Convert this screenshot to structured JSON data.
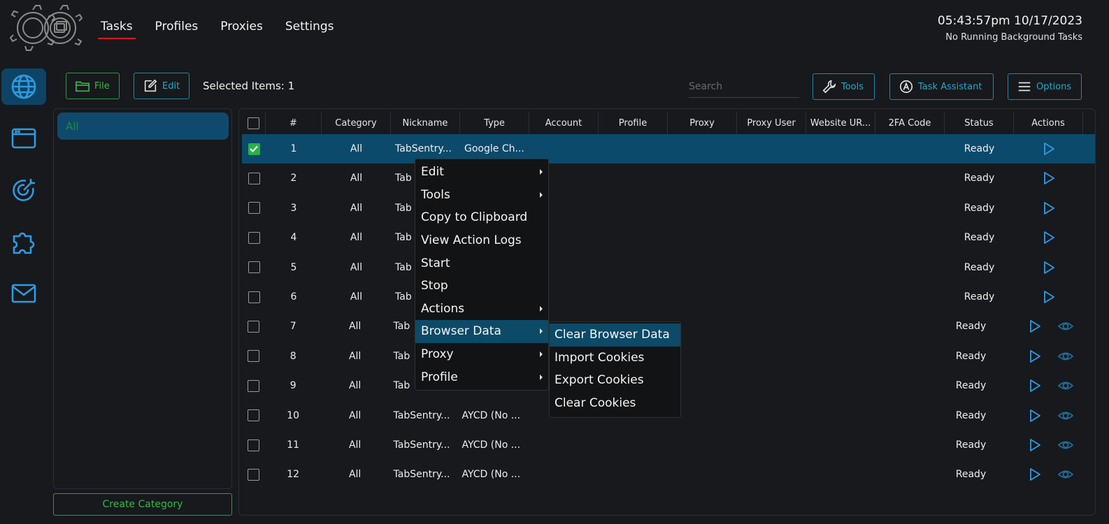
{
  "nav": {
    "tabs": [
      {
        "label": "Tasks"
      },
      {
        "label": "Profiles"
      },
      {
        "label": "Proxies"
      },
      {
        "label": "Settings"
      }
    ]
  },
  "header": {
    "clock": "05:43:57pm 10/17/2023",
    "background_status": "No Running Background Tasks"
  },
  "sidebar": {
    "items": [
      {
        "icon": "globe-icon"
      },
      {
        "icon": "browser-window-icon"
      },
      {
        "icon": "target-icon"
      },
      {
        "icon": "puzzle-icon"
      },
      {
        "icon": "mail-icon"
      }
    ]
  },
  "toolbar": {
    "file_label": "File",
    "edit_label": "Edit",
    "selected_items": "Selected Items: 1",
    "search_placeholder": "Search",
    "tools_label": "Tools",
    "task_assistant_label": "Task Assistant",
    "options_label": "Options"
  },
  "categories": {
    "items": [
      {
        "label": "All"
      }
    ],
    "create_label": "Create Category"
  },
  "table": {
    "columns": [
      "#",
      "Category",
      "Nickname",
      "Type",
      "Account",
      "Profile",
      "Proxy",
      "Proxy User",
      "Website UR...",
      "2FA Code",
      "Status",
      "Actions"
    ],
    "rows": [
      {
        "num": "1",
        "category": "All",
        "nickname": "TabSentry...",
        "type": "Google Ch...",
        "status": "Ready",
        "checked": true,
        "eye": false
      },
      {
        "num": "2",
        "category": "All",
        "nickname": "Tab",
        "type": "",
        "status": "Ready",
        "checked": false,
        "eye": false
      },
      {
        "num": "3",
        "category": "All",
        "nickname": "Tab",
        "type": "",
        "status": "Ready",
        "checked": false,
        "eye": false
      },
      {
        "num": "4",
        "category": "All",
        "nickname": "Tab",
        "type": "",
        "status": "Ready",
        "checked": false,
        "eye": false
      },
      {
        "num": "5",
        "category": "All",
        "nickname": "Tab",
        "type": "",
        "status": "Ready",
        "checked": false,
        "eye": false
      },
      {
        "num": "6",
        "category": "All",
        "nickname": "Tab",
        "type": "",
        "status": "Ready",
        "checked": false,
        "eye": false
      },
      {
        "num": "7",
        "category": "All",
        "nickname": "Tab",
        "type": "",
        "status": "Ready",
        "checked": false,
        "eye": true
      },
      {
        "num": "8",
        "category": "All",
        "nickname": "Tab",
        "type": "",
        "status": "Ready",
        "checked": false,
        "eye": true
      },
      {
        "num": "9",
        "category": "All",
        "nickname": "Tab",
        "type": "",
        "status": "Ready",
        "checked": false,
        "eye": true
      },
      {
        "num": "10",
        "category": "All",
        "nickname": "TabSentry...",
        "type": "AYCD (No ...",
        "status": "Ready",
        "checked": false,
        "eye": true
      },
      {
        "num": "11",
        "category": "All",
        "nickname": "TabSentry...",
        "type": "AYCD (No ...",
        "status": "Ready",
        "checked": false,
        "eye": true
      },
      {
        "num": "12",
        "category": "All",
        "nickname": "TabSentry...",
        "type": "AYCD (No ...",
        "status": "Ready",
        "checked": false,
        "eye": true
      }
    ]
  },
  "context_menu": {
    "items": [
      {
        "label": "Edit",
        "submenu": true
      },
      {
        "label": "Tools",
        "submenu": true
      },
      {
        "label": "Copy to Clipboard",
        "submenu": false
      },
      {
        "label": "View Action Logs",
        "submenu": false
      },
      {
        "label": "Start",
        "submenu": false
      },
      {
        "label": "Stop",
        "submenu": false
      },
      {
        "label": "Actions",
        "submenu": true
      },
      {
        "label": "Browser Data",
        "submenu": true,
        "highlighted": true
      },
      {
        "label": "Proxy",
        "submenu": true
      },
      {
        "label": "Profile",
        "submenu": true
      }
    ],
    "submenu_items": [
      {
        "label": "Clear Browser Data",
        "highlighted": true
      },
      {
        "label": "Import Cookies"
      },
      {
        "label": "Export Cookies"
      },
      {
        "label": "Clear Cookies"
      }
    ]
  },
  "colors": {
    "accent_blue": "#2aa6c4",
    "accent_green": "#3bb54a",
    "selection": "#0b4a6b",
    "active_tab_underline": "#d41b1b",
    "background": "#17191d"
  }
}
